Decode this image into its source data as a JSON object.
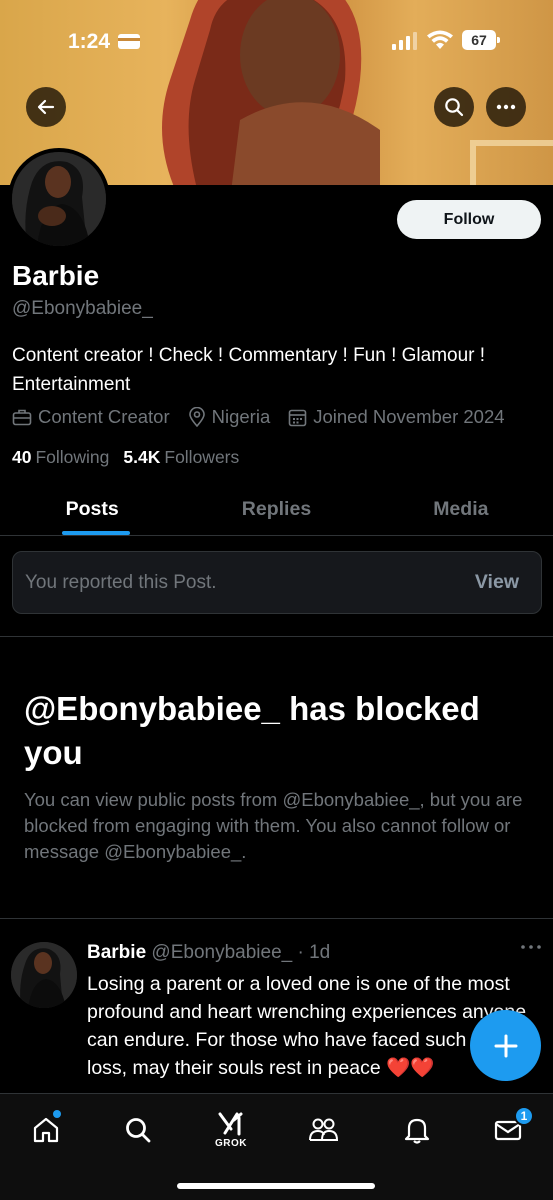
{
  "status_bar": {
    "time": "1:24",
    "battery": "67"
  },
  "profile": {
    "follow_label": "Follow",
    "name": "Barbie",
    "handle": "@Ebonybabiee_",
    "bio": "Content creator ! Check ! Commentary ! Fun ! Glamour ! Entertainment",
    "category": "Content Creator",
    "location": "Nigeria",
    "joined": "Joined November 2024",
    "following_count": "40",
    "following_label": "Following",
    "followers_count": "5.4K",
    "followers_label": "Followers"
  },
  "tabs": [
    {
      "label": "Posts",
      "active": true
    },
    {
      "label": "Replies",
      "active": false
    },
    {
      "label": "Media",
      "active": false
    }
  ],
  "reported": {
    "text": "You reported this Post.",
    "action": "View"
  },
  "blocked": {
    "title": "@Ebonybabiee_ has blocked you",
    "text": "You can view public posts from @Ebonybabiee_, but you are blocked from engaging with them. You also cannot follow or message @Ebonybabiee_."
  },
  "post": {
    "author": "Barbie",
    "handle": "@Ebonybabiee_",
    "separator": "·",
    "time": "1d",
    "text": "Losing a parent or a loved one is one of the most profound and heart wrenching experiences anyone can endure. For those who have faced such a loss, may their souls rest in peace ❤️❤️"
  },
  "bottom_nav": {
    "grok_label": "GROK",
    "messages_badge": "1"
  },
  "colors": {
    "accent": "#1d9bf0",
    "background": "#000000",
    "muted": "#71767b"
  }
}
